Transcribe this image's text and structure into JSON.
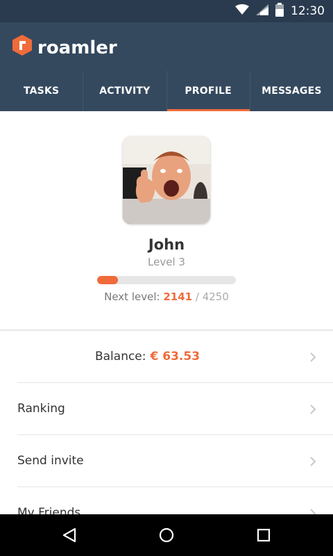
{
  "status_bar": {
    "time": "12:30"
  },
  "app": {
    "name": "roamler"
  },
  "tabs": [
    {
      "label": "TASKS"
    },
    {
      "label": "ACTIVITY"
    },
    {
      "label": "PROFILE"
    },
    {
      "label": "MESSAGES"
    }
  ],
  "profile": {
    "name": "John",
    "level": "Level 3",
    "progress_fraction": 0.15,
    "next_level_label": "Next level:",
    "next_level_current": "2141",
    "next_level_separator": "/",
    "next_level_target": "4250"
  },
  "menu": {
    "balance_label": "Balance:",
    "balance_value": "€ 63.53",
    "items": [
      {
        "label": "Ranking"
      },
      {
        "label": "Send invite"
      },
      {
        "label": "My Friends"
      }
    ]
  },
  "colors": {
    "accent": "#f06b3a",
    "appbar": "#34495e",
    "statusbar": "#2b3b4f"
  },
  "icons": {
    "status": [
      "wifi-icon",
      "signal-icon",
      "battery-icon"
    ],
    "nav": [
      "back-icon",
      "home-icon",
      "recents-icon"
    ],
    "row": "chevron-right-icon",
    "logo": "roamler-logo-icon"
  }
}
